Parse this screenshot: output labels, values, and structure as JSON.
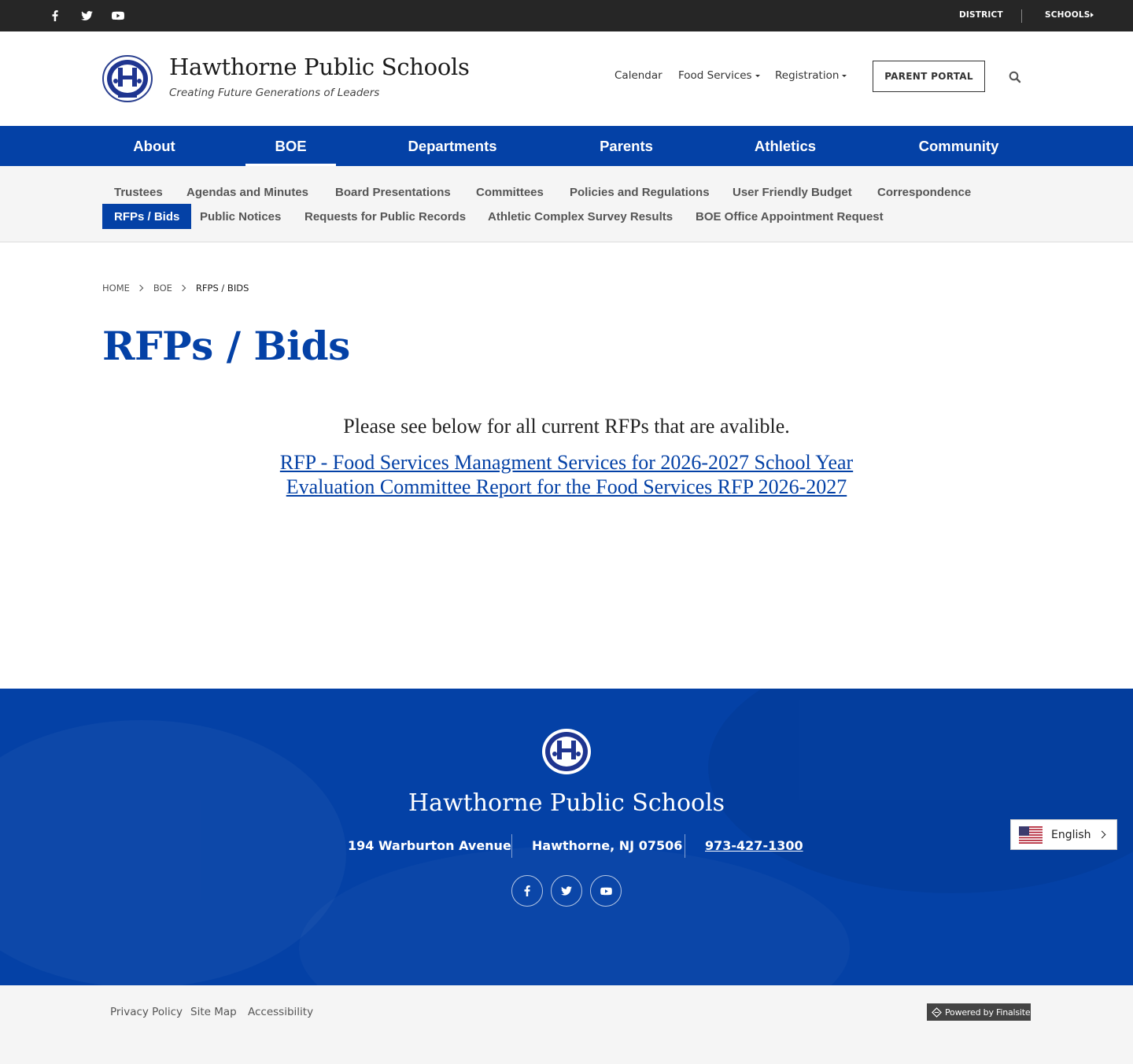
{
  "topbar": {
    "social_icons": [
      "facebook-icon",
      "twitter-icon",
      "youtube-icon"
    ],
    "district_label": "DISTRICT",
    "schools_label": "SCHOOLS"
  },
  "header": {
    "title": "Hawthorne Public Schools",
    "tagline": "Creating Future Generations of Leaders",
    "nav": {
      "calendar": "Calendar",
      "food_services": "Food Services",
      "registration": "Registration"
    },
    "portal_label": "PARENT PORTAL"
  },
  "main_nav": {
    "items": [
      "About",
      "BOE",
      "Departments",
      "Parents",
      "Athletics",
      "Community"
    ],
    "active": "BOE"
  },
  "sub_nav": {
    "row1": [
      "Trustees",
      "Agendas and Minutes",
      "Board Presentations",
      "Committees",
      "Policies and Regulations",
      "User Friendly Budget",
      "Correspondence"
    ],
    "row2": [
      "RFPs / Bids",
      "Public Notices",
      "Requests for Public Records",
      "Athletic Complex Survey Results",
      "BOE Office Appointment Request"
    ],
    "active": "RFPs / Bids"
  },
  "breadcrumb": [
    "HOME",
    "BOE",
    "RFPS / BIDS"
  ],
  "page": {
    "title": "RFPs / Bids",
    "intro": "Please see below for all current RFPs that are avalible.",
    "links": [
      "RFP - Food Services Managment Services for 2026-2027 School Year",
      "Evaluation Committee Report for the Food Services RFP 2026-2027"
    ]
  },
  "footer": {
    "title": "Hawthorne Public Schools",
    "address": "194 Warburton Avenue",
    "city": "Hawthorne, NJ  07506",
    "phone": "973-427-1300",
    "social_icons": [
      "facebook-icon",
      "twitter-icon",
      "youtube-icon"
    ]
  },
  "language": {
    "current": "English"
  },
  "bottom": {
    "links": [
      "Privacy Policy",
      "Site Map",
      "Accessibility"
    ],
    "powered_by": "Powered by Finalsite"
  },
  "colors": {
    "brand_blue": "#0441a6",
    "topbar": "#262626",
    "subnav_bg": "#f5f5f5"
  }
}
